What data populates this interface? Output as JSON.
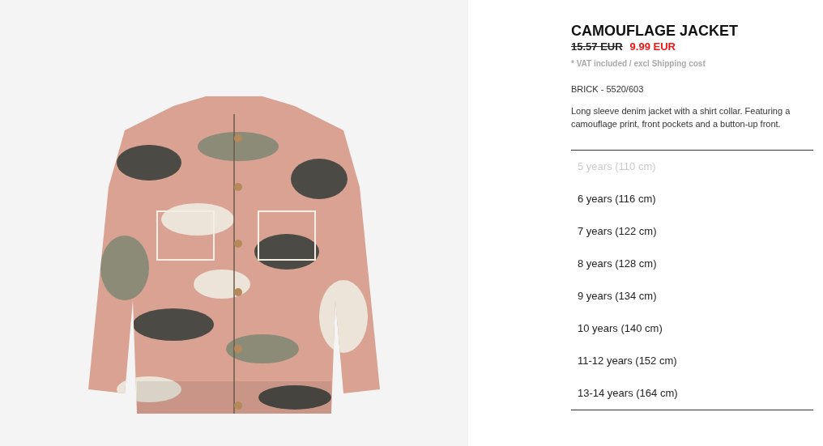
{
  "product": {
    "name": "CAMOUFLAGE JACKET",
    "old_price": "15.57 EUR",
    "price": "9.99 EUR",
    "tax_note": "* VAT included / excl Shipping cost",
    "color_ref": "BRICK - 5520/603",
    "description": "Long sleeve denim jacket with a shirt collar. Featuring a camouflage print, front pockets and a button-up front."
  },
  "sizes": [
    {
      "label": "5 years (110 cm)",
      "disabled": true
    },
    {
      "label": "6 years (116 cm)",
      "disabled": false
    },
    {
      "label": "7 years (122 cm)",
      "disabled": false
    },
    {
      "label": "8 years (128 cm)",
      "disabled": false
    },
    {
      "label": "9 years (134 cm)",
      "disabled": false
    },
    {
      "label": "10 years (140 cm)",
      "disabled": false
    },
    {
      "label": "11-12 years (152 cm)",
      "disabled": false
    },
    {
      "label": "13-14 years (164 cm)",
      "disabled": false
    }
  ]
}
